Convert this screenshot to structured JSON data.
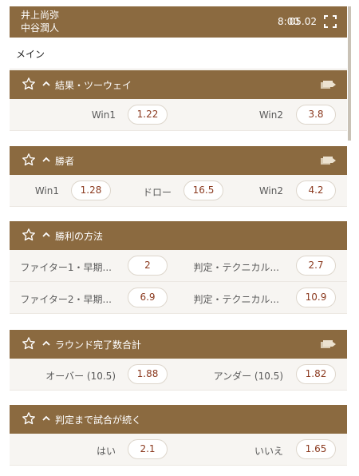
{
  "header": {
    "team1": "井上尚弥",
    "team2": "中谷潤人",
    "time": "8:00",
    "date": "05.02"
  },
  "main_tab": "メイン",
  "markets": [
    {
      "title": "結果・ツーウェイ",
      "rows": [
        [
          {
            "label": "Win1",
            "odd": "1.22"
          },
          {
            "label": "Win2",
            "odd": "3.8"
          }
        ]
      ]
    },
    {
      "title": "勝者",
      "rows": [
        [
          {
            "label": "Win1",
            "odd": "1.28"
          },
          {
            "label": "ドロー",
            "odd": "16.5"
          },
          {
            "label": "Win2",
            "odd": "4.2"
          }
        ]
      ]
    },
    {
      "title": "勝利の方法",
      "rows": [
        [
          {
            "label": "ファイター1・早期...",
            "odd": "2"
          },
          {
            "label": "判定・テクニカル...",
            "odd": "2.7"
          }
        ],
        [
          {
            "label": "ファイター2・早期...",
            "odd": "6.9"
          },
          {
            "label": "判定・テクニカル...",
            "odd": "10.9"
          }
        ]
      ]
    },
    {
      "title": "ラウンド完了数合計",
      "rows": [
        [
          {
            "label": "オーバー (10.5)",
            "odd": "1.88"
          },
          {
            "label": "アンダー (10.5)",
            "odd": "1.82"
          }
        ]
      ]
    },
    {
      "title": "判定まで試合が続く",
      "rows": [
        [
          {
            "label": "はい",
            "odd": "2.1"
          },
          {
            "label": "いいえ",
            "odd": "1.65"
          }
        ]
      ]
    }
  ],
  "colors": {
    "header_bg": "#8b6a40",
    "row_bg": "#f7f5f2",
    "odd_text": "#8b3a1f"
  },
  "icons": {
    "favorite": "star-icon",
    "collapse": "chevron-up-icon",
    "cashout": "cards-arrow-icon",
    "expand": "fullscreen-icon"
  }
}
